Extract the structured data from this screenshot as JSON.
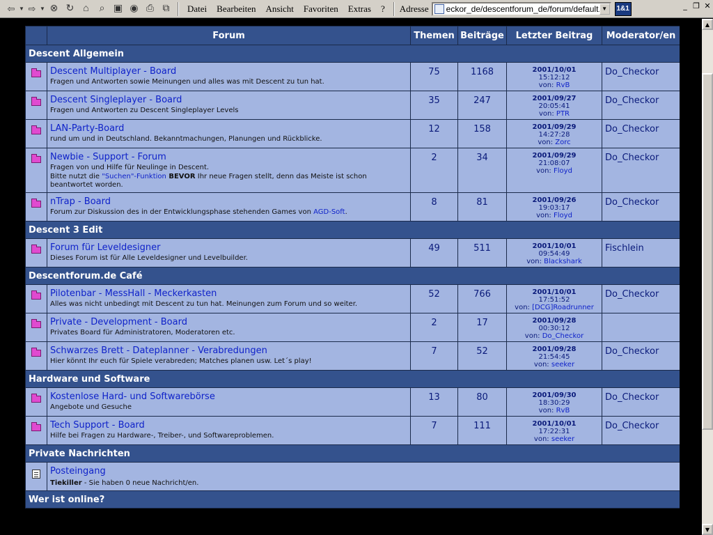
{
  "toolbar": {
    "buttons": [
      {
        "name": "back-button",
        "glyph": "⇦"
      },
      {
        "name": "forward-button",
        "glyph": "⇨"
      },
      {
        "name": "stop-button",
        "glyph": "⊗"
      },
      {
        "name": "refresh-button",
        "glyph": "↻"
      },
      {
        "name": "home-button",
        "glyph": "⌂"
      },
      {
        "name": "search-button",
        "glyph": "⌕"
      },
      {
        "name": "favorites-button",
        "glyph": "▣"
      },
      {
        "name": "history-button",
        "glyph": "◉"
      },
      {
        "name": "print-button",
        "glyph": "⎙"
      },
      {
        "name": "fullscreen-button",
        "glyph": "⧉"
      }
    ],
    "menu": [
      "Datei",
      "Bearbeiten",
      "Ansicht",
      "Favoriten",
      "Extras",
      "?"
    ],
    "address_label": "Adresse",
    "address_value": "eckor_de/descentforum_de/forum/default.asp",
    "brand": "1&1"
  },
  "window_controls": [
    "_",
    "❐",
    "✕"
  ],
  "table": {
    "headers": {
      "forum": "Forum",
      "topics": "Themen",
      "posts": "Beiträge",
      "last_post": "Letzter Beitrag",
      "moderators": "Moderator/en"
    },
    "categories": [
      {
        "name": "Descent Allgemein",
        "forums": [
          {
            "title": "Descent Multiplayer - Board",
            "desc": "Fragen und Antworten sowie Meinungen und alles was mit Descent zu tun hat.",
            "topics": "75",
            "posts": "1168",
            "date": "2001/10/01",
            "time": "15:12:12",
            "by_label": "von:",
            "by": "RvB",
            "mod": "Do_Checkor"
          },
          {
            "title": "Descent Singleplayer - Board",
            "desc": "Fragen und Antworten zu Descent Singleplayer Levels",
            "topics": "35",
            "posts": "247",
            "date": "2001/09/27",
            "time": "20:05:41",
            "by_label": "von:",
            "by": "PTR",
            "mod": "Do_Checkor"
          },
          {
            "title": "LAN-Party-Board",
            "desc": "rund um und in Deutschland. Bekanntmachungen, Planungen und Rückblicke.",
            "topics": "12",
            "posts": "158",
            "date": "2001/09/29",
            "time": "14:27:28",
            "by_label": "von:",
            "by": "Zorc",
            "mod": "Do_Checkor"
          },
          {
            "title": "Newbie - Support - Forum",
            "desc": "Fragen von und Hilfe für Neulinge in Descent.",
            "desc2_pre": "Bitte nutzt die ",
            "desc2_link": "\"Suchen\"-Funktion",
            "desc2_bold": " BEVOR",
            "desc2_post": " Ihr neue Fragen stellt, denn das Meiste ist schon beantwortet worden.",
            "topics": "2",
            "posts": "34",
            "date": "2001/09/29",
            "time": "21:08:07",
            "by_label": "von:",
            "by": "Floyd",
            "mod": "Do_Checkor"
          },
          {
            "title": "nTrap - Board",
            "desc_pre": "Forum zur Diskussion des in der Entwicklungsphase stehenden Games von ",
            "desc_link": "AGD-Soft",
            "desc_post": ".",
            "topics": "8",
            "posts": "81",
            "date": "2001/09/26",
            "time": "19:03:17",
            "by_label": "von:",
            "by": "Floyd",
            "mod": "Do_Checkor"
          }
        ]
      },
      {
        "name": "Descent 3 Edit",
        "forums": [
          {
            "title": "Forum für Leveldesigner",
            "desc": "Dieses Forum ist für Alle Leveldesigner und Levelbuilder.",
            "topics": "49",
            "posts": "511",
            "date": "2001/10/01",
            "time": "09:54:49",
            "by_label": "von:",
            "by": "Blackshark",
            "mod": "Fischlein"
          }
        ]
      },
      {
        "name": "Descentforum.de Café",
        "forums": [
          {
            "title": "Pilotenbar - MessHall - Meckerkasten",
            "desc": "Alles was nicht unbedingt mit Descent zu tun hat. Meinungen zum Forum und so weiter.",
            "topics": "52",
            "posts": "766",
            "date": "2001/10/01",
            "time": "17:51:52",
            "by_label": "von:",
            "by": "[DCG]Roadrunner",
            "mod": "Do_Checkor"
          },
          {
            "title": "Private - Development - Board",
            "desc": "Privates Board für Administratoren, Moderatoren etc.",
            "topics": "2",
            "posts": "17",
            "date": "2001/09/28",
            "time": "00:30:12",
            "by_label": "von:",
            "by": "Do_Checkor",
            "mod": ""
          },
          {
            "title": "Schwarzes Brett - Dateplanner - Verabredungen",
            "desc": "Hier könnt Ihr euch für Spiele verabreden; Matches planen usw. Let´s play!",
            "topics": "7",
            "posts": "52",
            "date": "2001/09/28",
            "time": "21:54:45",
            "by_label": "von:",
            "by": "seeker",
            "mod": "Do_Checkor"
          }
        ]
      },
      {
        "name": "Hardware und Software",
        "forums": [
          {
            "title": "Kostenlose Hard- und Softwarebörse",
            "desc": "Angebote und Gesuche",
            "topics": "13",
            "posts": "80",
            "date": "2001/09/30",
            "time": "18:30:29",
            "by_label": "von:",
            "by": "RvB",
            "mod": "Do_Checkor"
          },
          {
            "title": "Tech Support - Board",
            "desc": "Hilfe bei Fragen zu Hardware-, Treiber-, und Softwareproblemen.",
            "topics": "7",
            "posts": "111",
            "date": "2001/10/01",
            "time": "17:22:31",
            "by_label": "von:",
            "by": "seeker",
            "mod": "Do_Checkor"
          }
        ]
      }
    ],
    "private": {
      "name": "Private Nachrichten",
      "inbox_title": "Posteingang",
      "inbox_user": "Tiekiller",
      "inbox_text": " - Sie haben 0 neue Nachricht/en."
    },
    "online": {
      "name": "Wer ist online?"
    }
  },
  "colors": {
    "header_bg": "#34528d",
    "row_bg": "#a3b5e1",
    "link": "#0f22c9",
    "page_bg": "#000000"
  }
}
